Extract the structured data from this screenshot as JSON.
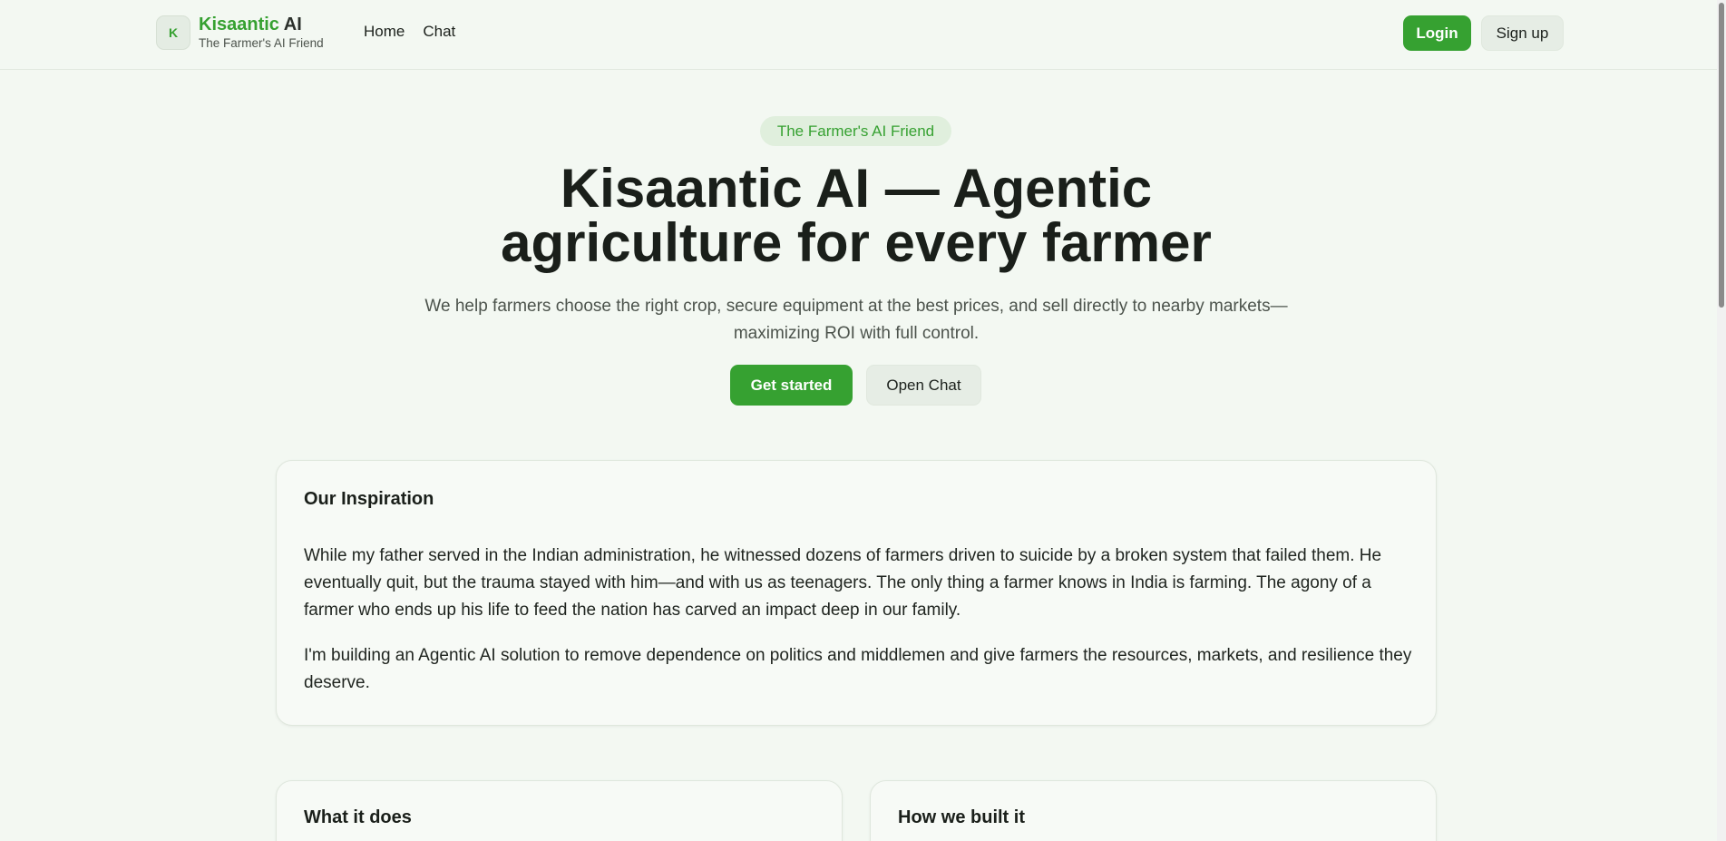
{
  "header": {
    "logo_letter": "K",
    "brand_name_accent": "Kisaantic",
    "brand_name_rest": " AI",
    "brand_tagline": "The Farmer's AI Friend",
    "nav": [
      {
        "label": "Home"
      },
      {
        "label": "Chat"
      }
    ],
    "login_label": "Login",
    "signup_label": "Sign up"
  },
  "hero": {
    "badge": "The Farmer's AI Friend",
    "title_line1": "Kisaantic AI — Agentic",
    "title_line2": "agriculture for every farmer",
    "subtitle_line1": "We help farmers choose the right crop, secure equipment at the best prices, and sell directly to nearby markets—",
    "subtitle_line2": "maximizing ROI with full control.",
    "cta_primary": "Get started",
    "cta_secondary": "Open Chat"
  },
  "inspiration": {
    "title": "Our Inspiration",
    "paragraph1": "While my father served in the Indian administration, he witnessed dozens of farmers driven to suicide by a broken system that failed them. He eventually quit, but the trauma stayed with him—and with us as teenagers. The only thing a farmer knows in India is farming. The agony of a farmer who ends up his life to feed the nation has carved an impact deep in our family.",
    "paragraph2": "I'm building an Agentic AI solution to remove dependence on politics and middlemen and give farmers the resources, markets, and resilience they deserve."
  },
  "cards": {
    "what_it_does_title": "What it does",
    "how_built_title": "How we built it"
  },
  "colors": {
    "accent": "#36a131",
    "background": "#f3f8f2",
    "text": "#1c211c"
  }
}
